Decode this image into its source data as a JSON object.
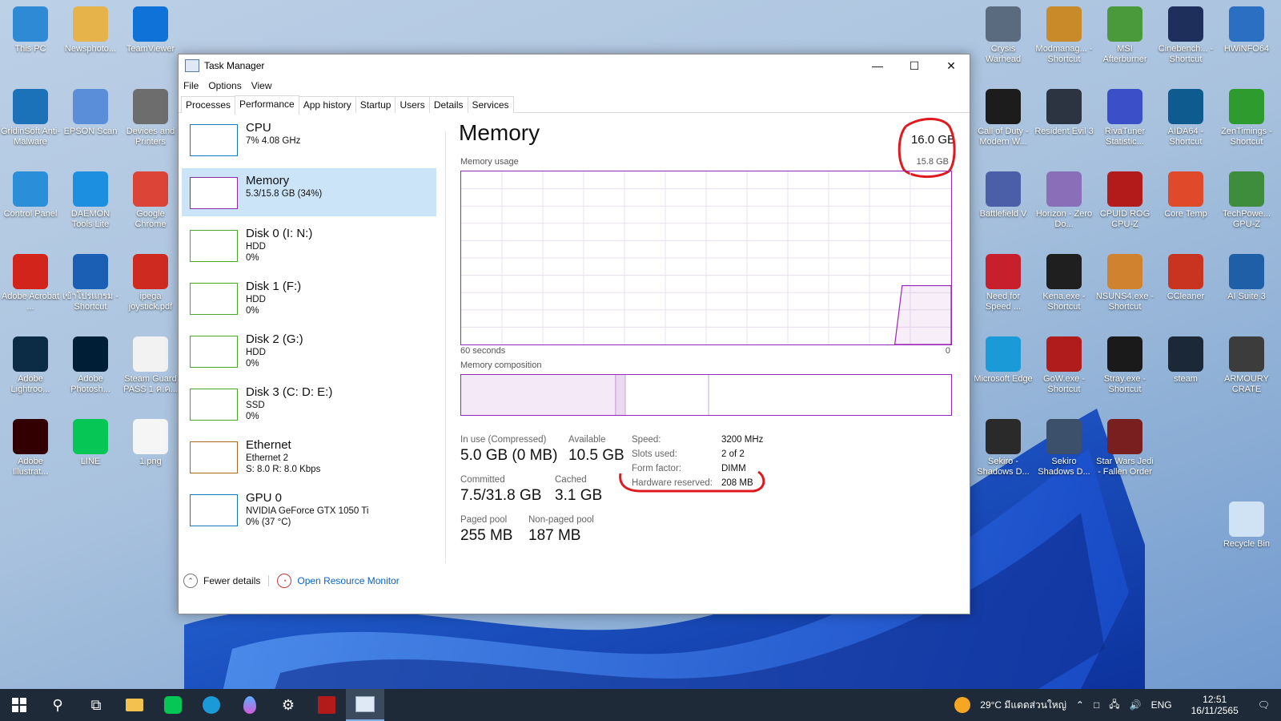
{
  "desktop": {
    "left_icons": [
      {
        "label": "This PC",
        "icon": "computer-icon",
        "color": "#2f8ad6"
      },
      {
        "label": "Newsphoto...",
        "icon": "folder-user-icon",
        "color": "#e6b34a"
      },
      {
        "label": "TeamViewer",
        "icon": "teamviewer-icon",
        "color": "#0e72d8"
      },
      {
        "label": "GridinSoft Anti-Malware",
        "icon": "bug-shield-icon",
        "color": "#1c72b8"
      },
      {
        "label": "EPSON Scan",
        "icon": "scanner-icon",
        "color": "#5b8ed8"
      },
      {
        "label": "Devices and Printers",
        "icon": "printer-icon",
        "color": "#6d6d6d"
      },
      {
        "label": "Control Panel",
        "icon": "control-panel-icon",
        "color": "#2b8ed9"
      },
      {
        "label": "DAEMON Tools Lite",
        "icon": "lightning-icon",
        "color": "#1d8fe0"
      },
      {
        "label": "Google Chrome",
        "icon": "chrome-icon",
        "color": "#db4437"
      },
      {
        "label": "Adobe Acrobat ...",
        "icon": "acrobat-icon",
        "color": "#d3241c"
      },
      {
        "label": "เข้าโปรแกรม - Shortcut",
        "icon": "dm-icon",
        "color": "#1b5fb5"
      },
      {
        "label": "ipega joystick.pdf",
        "icon": "pdf-file-icon",
        "color": "#cf2a20"
      },
      {
        "label": "Adobe Lightroo...",
        "icon": "lightroom-icon",
        "color": "#0c2b44"
      },
      {
        "label": "Adobe Photosh...",
        "icon": "photoshop-icon",
        "color": "#001e36"
      },
      {
        "label": "Steam Guard PASS 1 ค.ค...",
        "icon": "text-file-icon",
        "color": "#f2f2f2"
      },
      {
        "label": "Adobe Illustrat...",
        "icon": "illustrator-icon",
        "color": "#330000"
      },
      {
        "label": "LINE",
        "icon": "line-icon",
        "color": "#06c755"
      },
      {
        "label": "1.png",
        "icon": "image-file-icon",
        "color": "#f5f5f5"
      }
    ],
    "right_icons": [
      {
        "label": "Crysis Warhead",
        "icon": "crysis-icon",
        "color": "#5a6b80"
      },
      {
        "label": "Modmanag... - Shortcut",
        "icon": "mod-manager-icon",
        "color": "#c98a2a"
      },
      {
        "label": "MSI Afterburner",
        "icon": "afterburner-icon",
        "color": "#4a9a3c"
      },
      {
        "label": "Cinebench... - Shortcut",
        "icon": "cinebench-icon",
        "color": "#1d2f5a"
      },
      {
        "label": "HWiNFO64",
        "icon": "hwinfo-icon",
        "color": "#2a6fc2"
      },
      {
        "label": "Call of Duty - Modern W...",
        "icon": "cod-icon",
        "color": "#1c1c1c"
      },
      {
        "label": "Resident Evil 3",
        "icon": "re3-icon",
        "color": "#2b3440"
      },
      {
        "label": "RivaTuner Statistic...",
        "icon": "rivatuner-icon",
        "color": "#3a4fc8"
      },
      {
        "label": "AIDA64 - Shortcut",
        "icon": "aida64-icon",
        "color": "#0e5c8f"
      },
      {
        "label": "ZenTimings - Shortcut",
        "icon": "zentimings-icon",
        "color": "#2e9b2e"
      },
      {
        "label": "Battlefield V",
        "icon": "bfv-icon",
        "color": "#4b5fa8"
      },
      {
        "label": "Horizon - Zero Do...",
        "icon": "horizon-icon",
        "color": "#8a6fb8"
      },
      {
        "label": "CPUID ROG CPU-Z",
        "icon": "cpuz-icon",
        "color": "#b31b1b"
      },
      {
        "label": "Core Temp",
        "icon": "thermometer-icon",
        "color": "#e04a2a"
      },
      {
        "label": "TechPowe... GPU-Z",
        "icon": "gpuz-icon",
        "color": "#3d8d3d"
      },
      {
        "label": "Need for Speed ...",
        "icon": "nfs-icon",
        "color": "#c81f2d"
      },
      {
        "label": "Kena.exe - Shortcut",
        "icon": "kena-icon",
        "color": "#1f1f1f"
      },
      {
        "label": "NSUNS4.exe - Shortcut",
        "icon": "naruto-icon",
        "color": "#d0822e"
      },
      {
        "label": "CCleaner",
        "icon": "ccleaner-icon",
        "color": "#c8341f"
      },
      {
        "label": "AI Suite 3",
        "icon": "ai-suite-icon",
        "color": "#1f5fa8"
      },
      {
        "label": "Microsoft Edge",
        "icon": "edge-icon",
        "color": "#1a9ad6"
      },
      {
        "label": "GoW.exe - Shortcut",
        "icon": "gow-icon",
        "color": "#b01c1c"
      },
      {
        "label": "Stray.exe - Shortcut",
        "icon": "stray-icon",
        "color": "#1a1a1a"
      },
      {
        "label": "steam",
        "icon": "steam-icon",
        "color": "#1b2838"
      },
      {
        "label": "ARMOURY CRATE",
        "icon": "armoury-crate-icon",
        "color": "#3c3c3c"
      },
      {
        "label": "Sekiro - Shadows D...",
        "icon": "sekiro-icon",
        "color": "#2a2a2a"
      },
      {
        "label": "Sekiro Shadows D...",
        "icon": "trainer-icon",
        "color": "#3c4f6b"
      },
      {
        "label": "Star Wars Jedi - Fallen Order",
        "icon": "jedi-icon",
        "color": "#7a1f1f"
      },
      {
        "label": "Recycle Bin",
        "icon": "recycle-bin-icon",
        "color": "#cfe3f5"
      }
    ]
  },
  "window": {
    "title": "Task Manager",
    "menu": [
      "File",
      "Options",
      "View"
    ],
    "tabs": [
      "Processes",
      "Performance",
      "App history",
      "Startup",
      "Users",
      "Details",
      "Services"
    ],
    "active_tab": "Performance"
  },
  "sidebar": [
    {
      "name": "CPU",
      "sub1": "7%  4.08 GHz",
      "sub2": "",
      "sub3": "",
      "color": "#1779ba"
    },
    {
      "name": "Memory",
      "sub1": "5.3/15.8 GB (34%)",
      "sub2": "",
      "sub3": "",
      "color": "#8b2aa8"
    },
    {
      "name": "Disk 0 (I: N:)",
      "sub1": "HDD",
      "sub2": "0%",
      "sub3": "",
      "color": "#4ca62a"
    },
    {
      "name": "Disk 1 (F:)",
      "sub1": "HDD",
      "sub2": "0%",
      "sub3": "",
      "color": "#4ca62a"
    },
    {
      "name": "Disk 2 (G:)",
      "sub1": "HDD",
      "sub2": "0%",
      "sub3": "",
      "color": "#4ca62a"
    },
    {
      "name": "Disk 3 (C: D: E:)",
      "sub1": "SSD",
      "sub2": "0%",
      "sub3": "",
      "color": "#4ca62a"
    },
    {
      "name": "Ethernet",
      "sub1": "Ethernet 2",
      "sub2": "S: 8.0  R: 8.0 Kbps",
      "sub3": "",
      "color": "#a7671d"
    },
    {
      "name": "GPU 0",
      "sub1": "NVIDIA GeForce GTX 1050 Ti",
      "sub2": "0%  (37 °C)",
      "sub3": "",
      "color": "#1779ba"
    }
  ],
  "main": {
    "title": "Memory",
    "total": "16.0 GB",
    "usage_label": "Memory usage",
    "usage_max": "15.8 GB",
    "time_left": "60 seconds",
    "time_right": "0",
    "composition_label": "Memory composition",
    "usage_fraction": 0.34,
    "composition": {
      "in_use": 0.315,
      "modified": 0.02,
      "standby": 0.17
    }
  },
  "stats": {
    "in_use_label": "In use (Compressed)",
    "in_use_value": "5.0 GB (0 MB)",
    "available_label": "Available",
    "available_value": "10.5 GB",
    "committed_label": "Committed",
    "committed_value": "7.5/31.8 GB",
    "cached_label": "Cached",
    "cached_value": "3.1 GB",
    "paged_label": "Paged pool",
    "paged_value": "255 MB",
    "nonpaged_label": "Non-paged pool",
    "nonpaged_value": "187 MB",
    "speed_label": "Speed:",
    "speed_value": "3200 MHz",
    "slots_label": "Slots used:",
    "slots_value": "2 of 2",
    "form_label": "Form factor:",
    "form_value": "DIMM",
    "hwres_label": "Hardware reserved:",
    "hwres_value": "208 MB"
  },
  "footer": {
    "fewer_details": "Fewer details",
    "resource_monitor": "Open Resource Monitor"
  },
  "taskbar": {
    "weather": "29°C  มีแดดส่วนใหญ่",
    "lang": "ENG",
    "time": "12:51",
    "date": "16/11/2565"
  },
  "colors": {
    "memory_accent": "#9528b4",
    "annotation_red": "#e0191f",
    "selection": "#cce4f7",
    "link": "#0a64c8"
  }
}
